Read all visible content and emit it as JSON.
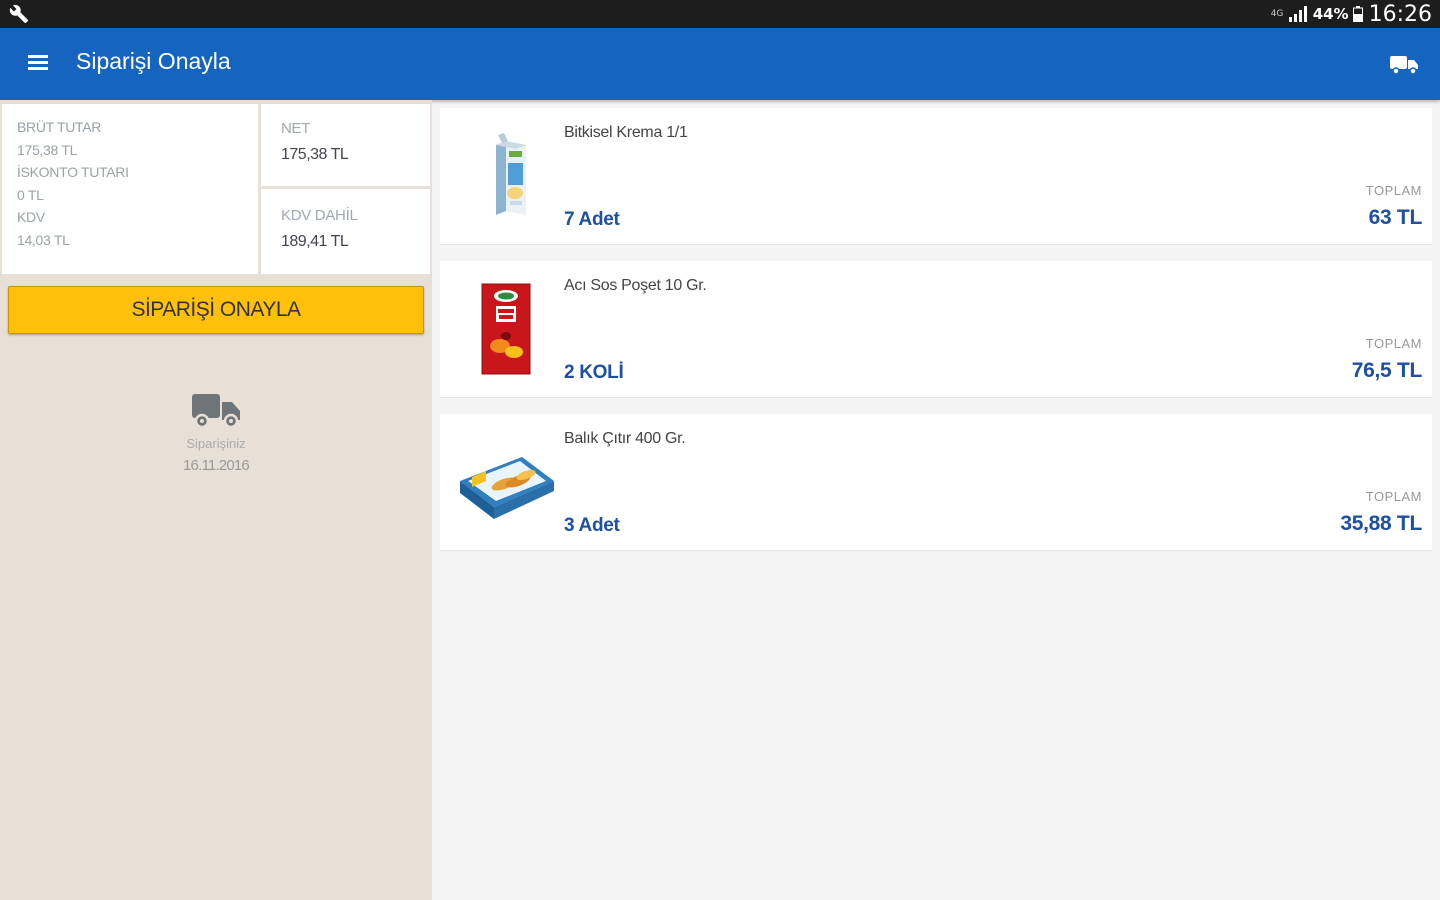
{
  "status_bar": {
    "sim_label": "4G",
    "battery_percent": "44%",
    "time": "16:26"
  },
  "app_bar": {
    "title": "Siparişi Onayla",
    "menu_icon": "hamburger-menu-icon",
    "action_icon": "truck-icon"
  },
  "summary": {
    "brut_label": "BRÜT TUTAR",
    "brut_value": "175,38 TL",
    "iskonto_label": "İSKONTO TUTARI",
    "iskonto_value": "0 TL",
    "kdv_label": "KDV",
    "kdv_value": "14,03 TL",
    "net_label": "NET",
    "net_value": "175,38 TL",
    "kdv_dahil_label": "KDV DAHİL",
    "kdv_dahil_value": "189,41 TL"
  },
  "confirm_button_label": "SİPARİŞİ ONAYLA",
  "delivery": {
    "label": "Siparişiniz",
    "date": "16.11.2016"
  },
  "products": [
    {
      "name": "Bitkisel Krema 1/1",
      "quantity": "7 Adet",
      "total_label": "TOPLAM",
      "total": "63 TL"
    },
    {
      "name": "Acı Sos Poşet 10 Gr.",
      "quantity": "2 KOLİ",
      "total_label": "TOPLAM",
      "total": "76,5 TL"
    },
    {
      "name": "Balık Çıtır 400 Gr.",
      "quantity": "3 Adet",
      "total_label": "TOPLAM",
      "total": "35,88 TL"
    }
  ],
  "colors": {
    "app_bar": "#1565c0",
    "accent_button": "#fec00b",
    "price_blue": "#1e4fa3",
    "left_panel": "#e8e0d7"
  }
}
